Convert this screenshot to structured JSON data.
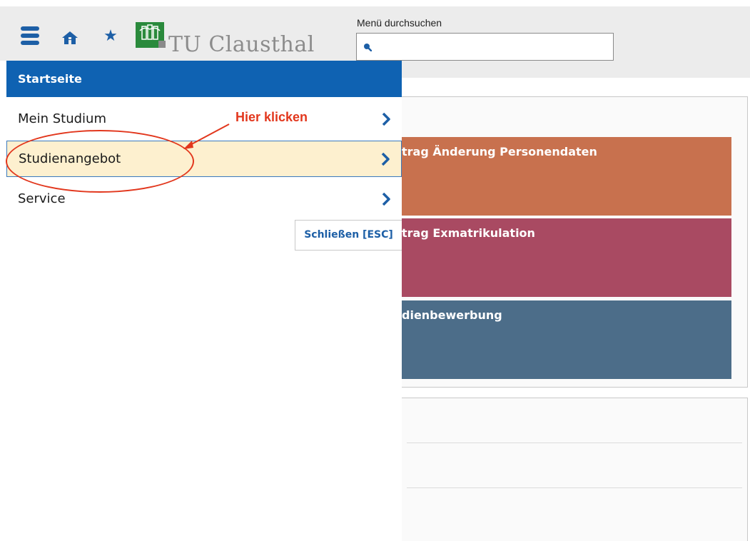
{
  "header": {
    "logo_text": "TU Clausthal",
    "search_label": "Menü durchsuchen",
    "search_value": "",
    "icons": [
      "menu-icon",
      "home-icon",
      "star-icon",
      "search-icon"
    ]
  },
  "background_tiles": [
    {
      "label": "trag Änderung Personendaten",
      "color": "#c8714e"
    },
    {
      "label": "trag Exmatrikulation",
      "color": "#a94a62"
    },
    {
      "label": "dienbewerbung",
      "color": "#4c6d89"
    }
  ],
  "drawer": {
    "title": "Startseite",
    "items": [
      {
        "label": "Mein Studium"
      },
      {
        "label": "Studienangebot",
        "highlighted": true
      },
      {
        "label": "Service"
      }
    ],
    "close_label": "Schließen [ESC]"
  },
  "annotation": {
    "text": "Hier klicken",
    "color": "#e2371d"
  },
  "colors": {
    "primary": "#0f62b2",
    "highlight": "#fdf0cf",
    "logo_green": "#2a8a3c"
  }
}
